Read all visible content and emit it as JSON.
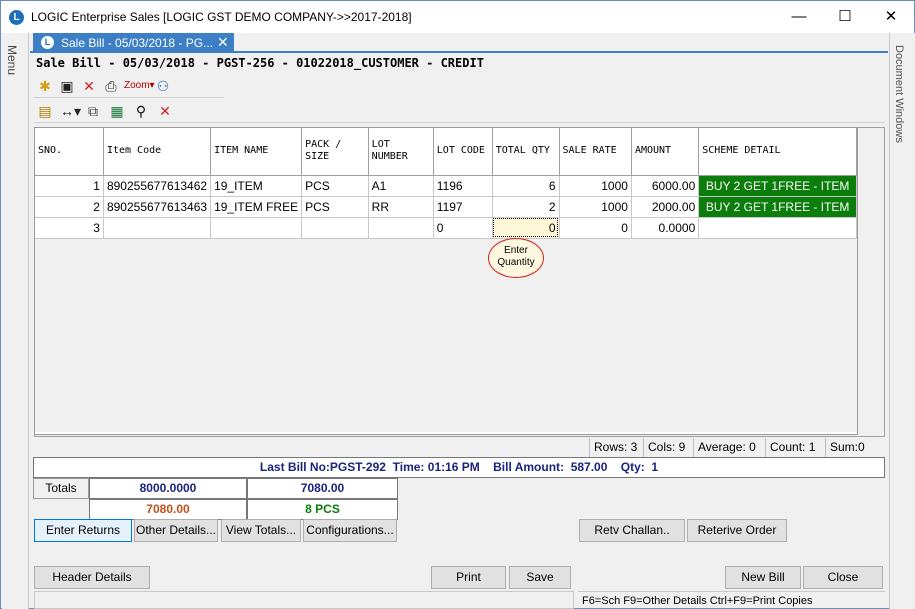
{
  "window": {
    "title": "LOGIC Enterprise Sales  [LOGIC GST DEMO COMPANY->>2017-2018]",
    "logo_glyph": "L",
    "minimize": "—",
    "maximize": "☐",
    "close": "✕"
  },
  "side": {
    "left_label": "Menu",
    "right_label": "Document Windows"
  },
  "tab": {
    "icon_glyph": "L",
    "label": "Sale Bill - 05/03/2018 - PG...",
    "close": "✕"
  },
  "form_title": "Sale Bill - 05/03/2018 - PGST-256 - 01022018_CUSTOMER - CREDIT",
  "toolbar1": [
    {
      "name": "new-icon",
      "glyph": "✱",
      "color": "#d4a017"
    },
    {
      "name": "save-icon",
      "glyph": "▣",
      "color": "#222222"
    },
    {
      "name": "delete-icon",
      "glyph": "✕",
      "color": "#d42020"
    },
    {
      "name": "print-icon",
      "glyph": "⎙",
      "color": "#333333"
    },
    {
      "name": "zoom-icon",
      "glyph": "Zoom▾",
      "color": "#b00000"
    },
    {
      "name": "users-icon",
      "glyph": "⚇",
      "color": "#1e6fb8"
    }
  ],
  "toolbar2": [
    {
      "name": "report-icon",
      "glyph": "▤",
      "color": "#b08000"
    },
    {
      "name": "columns-icon",
      "glyph": "↔▾",
      "color": "#222222"
    },
    {
      "name": "copy-icon",
      "glyph": "⧉",
      "color": "#444444"
    },
    {
      "name": "excel-icon",
      "glyph": "▦",
      "color": "#1d7a3a"
    },
    {
      "name": "find-icon",
      "glyph": "⚲",
      "color": "#111111"
    },
    {
      "name": "cancel-icon",
      "glyph": "✕",
      "color": "#d42020"
    }
  ],
  "grid": {
    "headers": [
      "SNO.",
      "Item Code",
      "ITEM NAME",
      "PACK / SIZE",
      "LOT NUMBER",
      "LOT CODE",
      "TOTAL QTY",
      "SALE RATE",
      "AMOUNT",
      "SCHEME DETAIL"
    ],
    "rows": [
      {
        "sno": "1",
        "item_code": "890255677613462",
        "item_name": "19_ITEM",
        "pack": "PCS",
        "lot_number": "A1",
        "lot_code": "1196",
        "qty": "6",
        "rate": "1000",
        "amount": "6000.00",
        "scheme": "BUY 2 GET 1FREE - ITEM"
      },
      {
        "sno": "2",
        "item_code": "890255677613463",
        "item_name": "19_ITEM FREE",
        "pack": "PCS",
        "lot_number": "RR",
        "lot_code": "1197",
        "qty": "2",
        "rate": "1000",
        "amount": "2000.00",
        "scheme": "BUY 2 GET 1FREE - ITEM"
      },
      {
        "sno": "3",
        "item_code": "",
        "item_name": "",
        "pack": "",
        "lot_number": "",
        "lot_code": "0",
        "qty": "0",
        "rate": "0",
        "amount": "0.0000",
        "scheme": ""
      }
    ],
    "scheme_color": "#0a7d0a"
  },
  "hint": {
    "line1": "Enter",
    "line2": "Quantity"
  },
  "status": {
    "rows": "Rows: 3",
    "cols": "Cols: 9",
    "average": "Average: 0",
    "count": "Count: 1",
    "sum": "Sum:0"
  },
  "last_bill": {
    "bill_no_label": "Last Bill No:",
    "bill_no": "PGST-292",
    "time_label": "Time:",
    "time": "01:16 PM",
    "amount_label": "Bill Amount:",
    "amount": "587.00",
    "qty_label": "Qty:",
    "qty": "1"
  },
  "totals": {
    "label": "Totals",
    "total_amount": "8000.0000",
    "net_amount": "7080.00",
    "bill_total": "7080.00",
    "pcs": "8 PCS",
    "colors": {
      "blue": "#1a237e",
      "orange": "#c0501a",
      "green": "#0a7d0a"
    }
  },
  "buttons": {
    "enter_returns": "Enter Returns",
    "other_details": "Other Details...",
    "view_totals": "View Totals...",
    "configurations": "Configurations...",
    "retv_challan": "Retv Challan..",
    "retrieve_order": "Reterive Order",
    "header_details": "Header Details",
    "print": "Print",
    "save": "Save",
    "new_bill": "New Bill",
    "close": "Close"
  },
  "footer_status": "F6=Sch  F9=Other Details  Ctrl+F9=Print Copies"
}
